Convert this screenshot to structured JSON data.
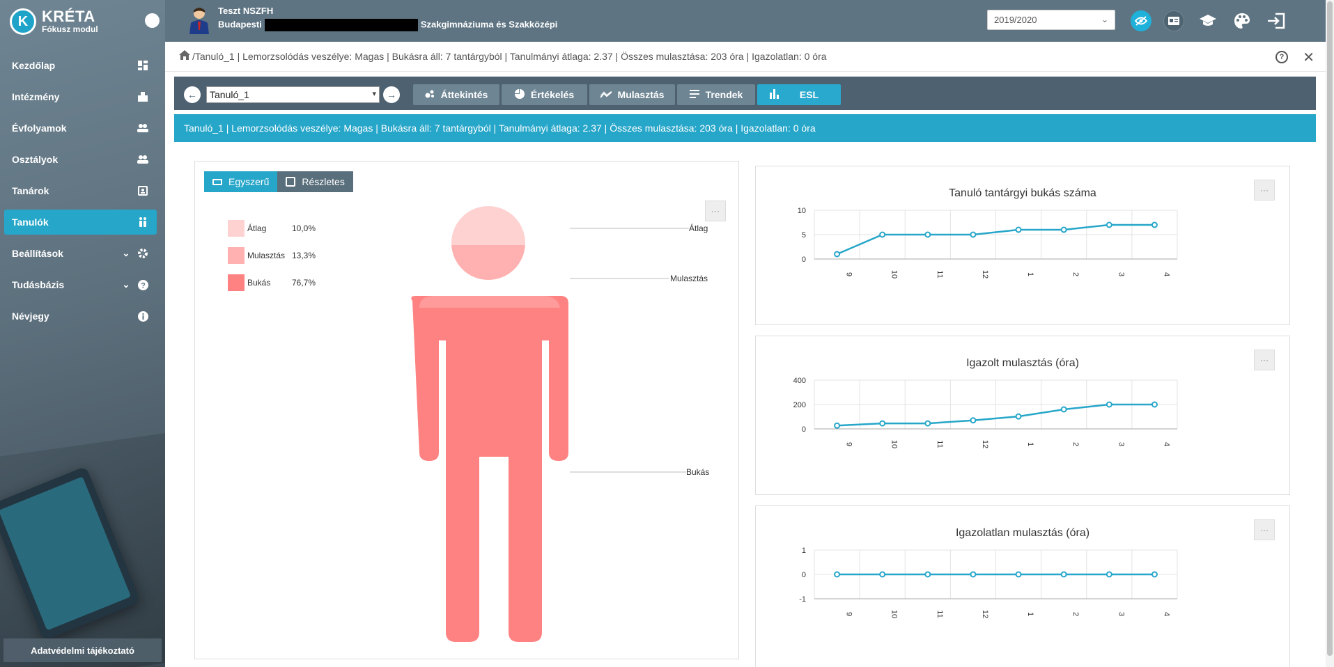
{
  "sidebar": {
    "logo_title": "KRÉTA",
    "logo_subtitle": "Fókusz modul",
    "items": [
      {
        "label": "Kezdőlap",
        "icon": "dashboard-icon"
      },
      {
        "label": "Intézmény",
        "icon": "building-icon"
      },
      {
        "label": "Évfolyamok",
        "icon": "people-icon"
      },
      {
        "label": "Osztályok",
        "icon": "people-icon"
      },
      {
        "label": "Tanárok",
        "icon": "teacher-icon"
      },
      {
        "label": "Tanulók",
        "icon": "students-icon",
        "active": true
      },
      {
        "label": "Beállítások",
        "icon": "gear-icon",
        "expandable": true
      },
      {
        "label": "Tudásbázis",
        "icon": "help-icon",
        "expandable": true
      },
      {
        "label": "Névjegy",
        "icon": "info-icon"
      }
    ],
    "privacy_link": "Adatvédelmi tájékoztató"
  },
  "topbar": {
    "user_name": "Teszt NSZFH",
    "school_prefix": "Budapesti",
    "school_suffix": "Szakgimnáziuma és Szakközépi",
    "school_year": "2019/2020",
    "accent": "#1fb1d9"
  },
  "breadcrumb": {
    "text": "/Tanuló_1 | Lemorzsolódás veszélye: Magas | Bukásra áll: 7 tantárgyból | Tanulmányi átlaga: 2.37 | Összes mulasztása: 203 óra | Igazolatlan: 0 óra"
  },
  "toolbar": {
    "student": "Tanuló_1",
    "tabs": [
      {
        "label": "Áttekintés",
        "icon": "overview-icon"
      },
      {
        "label": "Értékelés",
        "icon": "pie-icon"
      },
      {
        "label": "Mulasztás",
        "icon": "trend-icon"
      },
      {
        "label": "Trendek",
        "icon": "list-icon"
      },
      {
        "label": "ESL",
        "icon": "bar-chart-icon",
        "active": true
      }
    ]
  },
  "info_strip": "Tanuló_1 | Lemorzsolódás veszélye: Magas | Bukásra áll: 7 tantárgyból | Tanulmányi átlaga: 2.37 | Összes mulasztása: 203 óra | Igazolatlan: 0 óra",
  "figure": {
    "view_simple": "Egyszerű",
    "view_detailed": "Részletes",
    "legend": [
      {
        "label": "Átlag",
        "value": "10,0%",
        "color": "#ffd2d2"
      },
      {
        "label": "Mulasztás",
        "value": "13,3%",
        "color": "#ffb0b0"
      },
      {
        "label": "Bukás",
        "value": "76,7%",
        "color": "#ff8282"
      }
    ],
    "callouts": [
      "Átlag",
      "Mulasztás",
      "Bukás"
    ],
    "more": "···"
  },
  "chart_data": [
    {
      "type": "line",
      "title": "Tanuló tantárgyi bukás száma",
      "categories": [
        "9",
        "10",
        "11",
        "12",
        "1",
        "2",
        "3",
        "4"
      ],
      "values": [
        1,
        5,
        5,
        5,
        6,
        6,
        7,
        7
      ],
      "ylim": [
        0,
        10
      ],
      "yticks": [
        0,
        5,
        10
      ],
      "color": "#26a6c9",
      "grid": true
    },
    {
      "type": "line",
      "title": "Igazolt mulasztás (óra)",
      "categories": [
        "9",
        "10",
        "11",
        "12",
        "1",
        "2",
        "3",
        "4"
      ],
      "values": [
        27,
        45,
        45,
        70,
        102,
        160,
        200,
        200
      ],
      "ylim": [
        0,
        400
      ],
      "yticks": [
        0,
        200,
        400
      ],
      "color": "#26a6c9",
      "grid": true
    },
    {
      "type": "line",
      "title": "Igazolatlan mulasztás (óra)",
      "categories": [
        "9",
        "10",
        "11",
        "12",
        "1",
        "2",
        "3",
        "4"
      ],
      "values": [
        0,
        0,
        0,
        0,
        0,
        0,
        0,
        0
      ],
      "ylim": [
        -1,
        1
      ],
      "yticks": [
        -1,
        0,
        1
      ],
      "color": "#26a6c9",
      "grid": true
    }
  ]
}
